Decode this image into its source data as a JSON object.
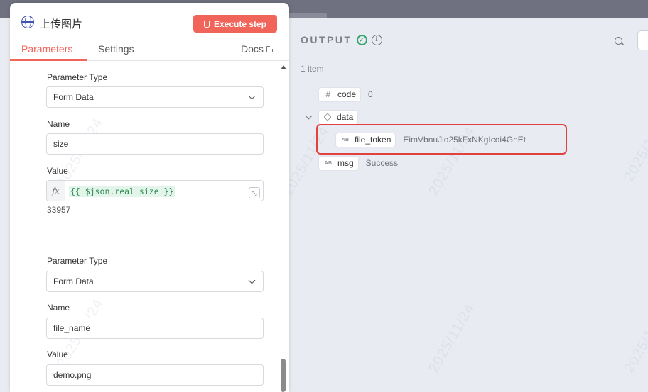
{
  "panel": {
    "title": "上传图片",
    "execute_label": "Execute step",
    "tabs": [
      "Parameters",
      "Settings"
    ],
    "docs_label": "Docs"
  },
  "params": [
    {
      "type_label": "Parameter Type",
      "type_value": "Form Data",
      "name_label": "Name",
      "name_value": "size",
      "value_label": "Value",
      "value_expr": "{{ $json.real_size }}",
      "value_result": "33957"
    },
    {
      "type_label": "Parameter Type",
      "type_value": "Form Data",
      "name_label": "Name",
      "name_value": "file_name",
      "value_label": "Value",
      "value_text": "demo.png"
    }
  ],
  "output": {
    "title": "OUTPUT",
    "item_count": "1 item",
    "rows": [
      {
        "type_icon": "#",
        "key": "code",
        "value": "0"
      },
      {
        "type_icon": "cube",
        "key": "data",
        "value": ""
      },
      {
        "type_icon": "AB",
        "key": "file_token",
        "value": "EimVbnuJlo25kFxNKgIcoi4GnEt"
      },
      {
        "type_icon": "AB",
        "key": "msg",
        "value": "Success"
      }
    ]
  },
  "colors": {
    "accent": "#f0645a",
    "highlight": "#e0433f",
    "success": "#33a36a",
    "globe": "#3f51b5"
  }
}
